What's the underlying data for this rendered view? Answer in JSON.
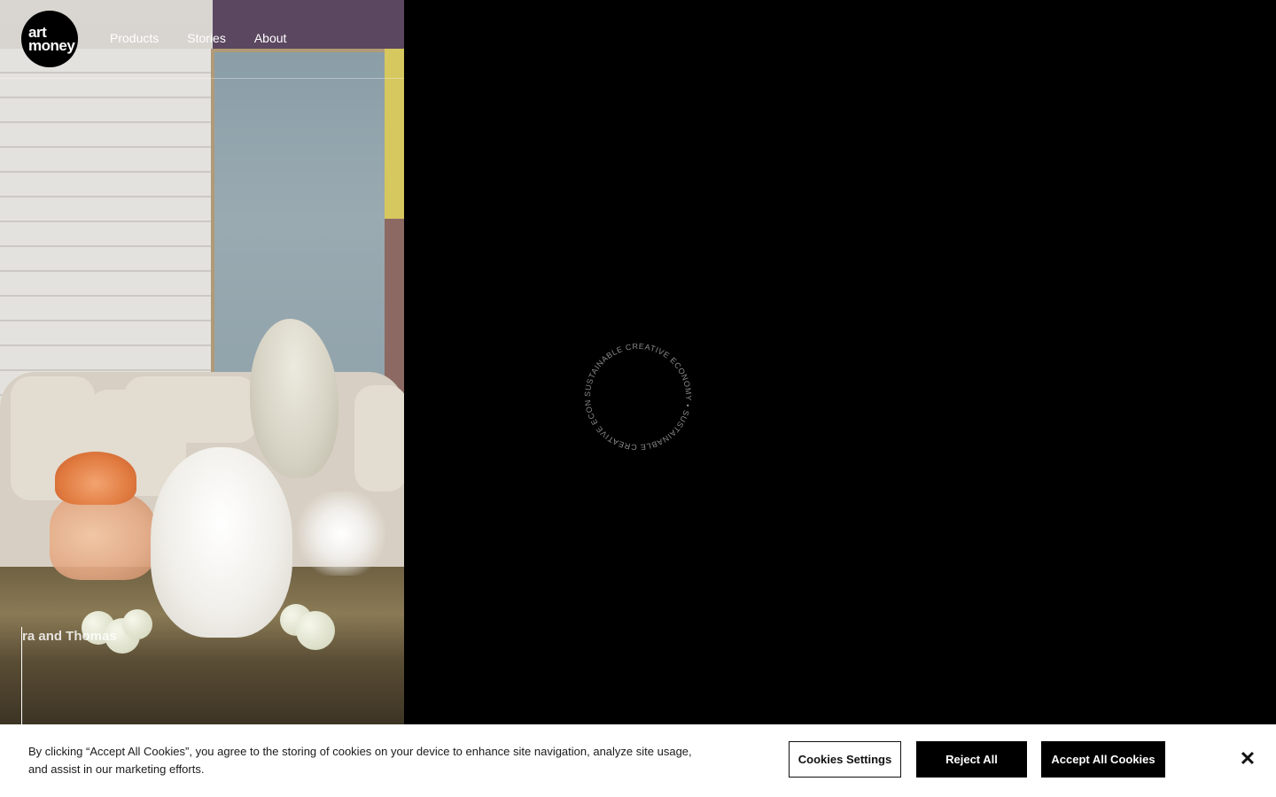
{
  "header": {
    "logo_line1": "art",
    "logo_line2": "money",
    "nav": [
      {
        "label": "Products"
      },
      {
        "label": "Stories"
      },
      {
        "label": "About"
      }
    ]
  },
  "hero": {
    "caption": "ra and Thomas"
  },
  "badge": {
    "text": "SUSTAINABLE CREATIVE ECONOMY • SUSTAINABLE CREATIVE ECONOMY •"
  },
  "cookie_banner": {
    "text": "By clicking “Accept All Cookies”, you agree to the storing of cookies on your device to enhance site navigation, analyze site usage, and assist in our marketing efforts.",
    "settings_label": "Cookies Settings",
    "reject_label": "Reject All",
    "accept_label": "Accept All Cookies",
    "close_icon": "close-icon"
  },
  "colors": {
    "background": "#000000",
    "banner": "#ffffff",
    "button_dark": "#000000"
  }
}
